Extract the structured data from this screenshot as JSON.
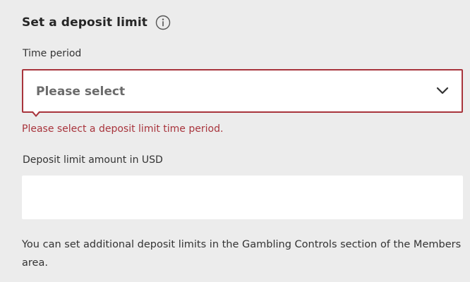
{
  "form": {
    "title": "Set a deposit limit",
    "info_icon": "info-icon",
    "time_period": {
      "label": "Time period",
      "selected_value": "Please select",
      "error": "Please select a deposit limit time period."
    },
    "amount": {
      "label": "Deposit limit amount in USD",
      "value": "",
      "placeholder": ""
    },
    "footnote": "You can set additional deposit limits in the Gambling Controls section of the Members area."
  },
  "colors": {
    "background": "#ececec",
    "error": "#a8343c",
    "field_background": "#ffffff"
  }
}
